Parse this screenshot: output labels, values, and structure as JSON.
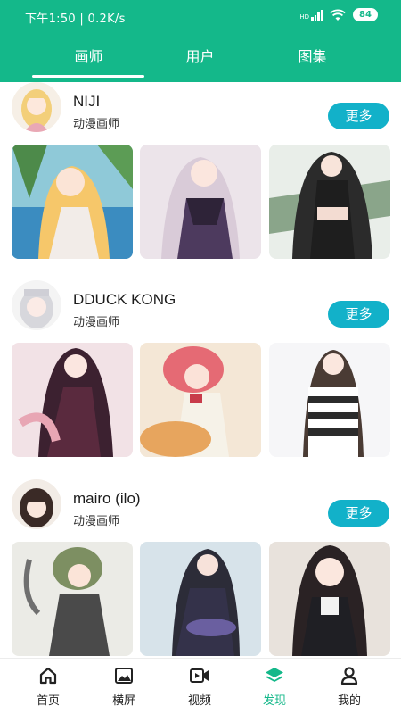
{
  "status_bar": {
    "time_speed": "下午1:50 | 0.2K/s",
    "network": "HD",
    "battery": "84"
  },
  "tabs": [
    {
      "label": "画师",
      "active": true
    },
    {
      "label": "用户",
      "active": false
    },
    {
      "label": "图集",
      "active": false
    }
  ],
  "artists": [
    {
      "name": "NIJI",
      "role": "动漫画师",
      "more_label": "更多"
    },
    {
      "name": "DDUCK KONG",
      "role": "动漫画师",
      "more_label": "更多"
    },
    {
      "name": "mairo (ilo)",
      "role": "动漫画师",
      "more_label": "更多"
    }
  ],
  "bottom_nav": [
    {
      "label": "首页",
      "icon": "home-icon",
      "active": false
    },
    {
      "label": "横屏",
      "icon": "landscape-image-icon",
      "active": false
    },
    {
      "label": "视频",
      "icon": "video-icon",
      "active": false
    },
    {
      "label": "发现",
      "icon": "layers-icon",
      "active": true
    },
    {
      "label": "我的",
      "icon": "user-icon",
      "active": false
    }
  ],
  "colors": {
    "primary": "#14b88a",
    "more_button": "#12b1c9",
    "nav_active": "#14b88a"
  }
}
